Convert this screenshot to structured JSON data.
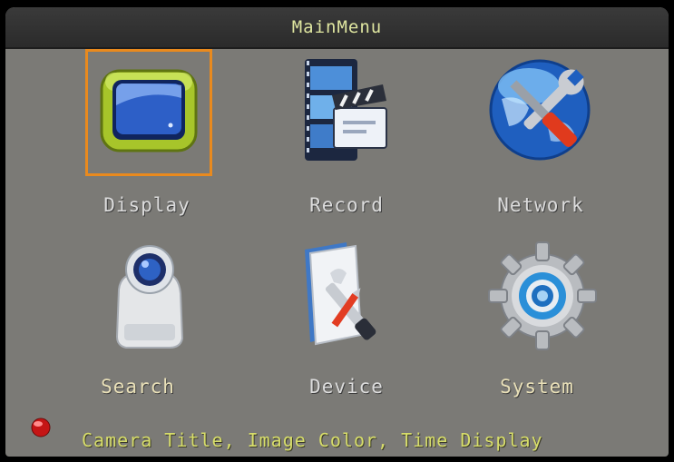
{
  "title": "MainMenu",
  "menu": {
    "items": [
      {
        "label": "Display",
        "icon": "monitor-icon",
        "selected": true
      },
      {
        "label": "Record",
        "icon": "film-clapper-icon",
        "selected": false
      },
      {
        "label": "Network",
        "icon": "globe-wrench-icon",
        "selected": false
      },
      {
        "label": "Search",
        "icon": "camera-icon",
        "selected": false
      },
      {
        "label": "Device",
        "icon": "folder-tools-icon",
        "selected": false
      },
      {
        "label": "System",
        "icon": "gear-icon",
        "selected": false
      }
    ]
  },
  "status": {
    "hint": "Camera Title, Image Color, Time Display",
    "indicator": "red-led-icon"
  },
  "colors": {
    "background": "#7b7a76",
    "titlebar": "#2f2f2f",
    "title_text": "#dfe6a0",
    "selection": "#e98a1e",
    "hint_text": "#d7dd6a"
  }
}
